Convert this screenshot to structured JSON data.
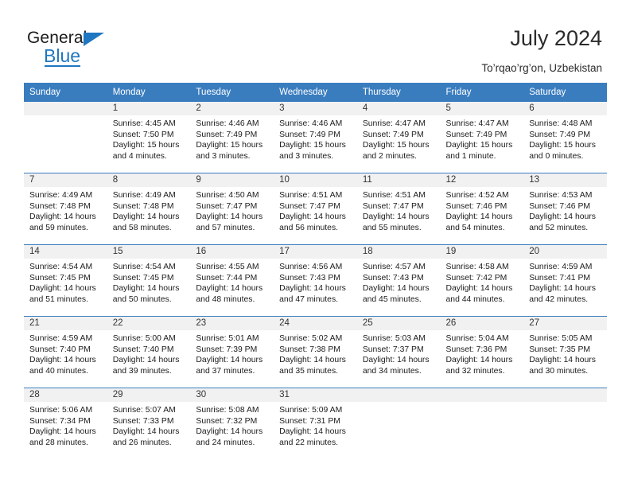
{
  "logo": {
    "word_top": "General",
    "word_bottom": "Blue",
    "triangle_color": "#1f77c1"
  },
  "header": {
    "title": "July 2024",
    "subtitle": "To’rqao’rg’on, Uzbekistan"
  },
  "colors": {
    "header_blue": "#3a7dbf",
    "daynum_band": "#f1f1f1",
    "text": "#1c1c1c"
  },
  "calendar": {
    "weekday_headers": [
      "Sunday",
      "Monday",
      "Tuesday",
      "Wednesday",
      "Thursday",
      "Friday",
      "Saturday"
    ],
    "weeks": [
      [
        {
          "day": "",
          "sunrise": "",
          "sunset": "",
          "daylight_line1": "",
          "daylight_line2": ""
        },
        {
          "day": "1",
          "sunrise": "Sunrise: 4:45 AM",
          "sunset": "Sunset: 7:50 PM",
          "daylight_line1": "Daylight: 15 hours",
          "daylight_line2": "and 4 minutes."
        },
        {
          "day": "2",
          "sunrise": "Sunrise: 4:46 AM",
          "sunset": "Sunset: 7:49 PM",
          "daylight_line1": "Daylight: 15 hours",
          "daylight_line2": "and 3 minutes."
        },
        {
          "day": "3",
          "sunrise": "Sunrise: 4:46 AM",
          "sunset": "Sunset: 7:49 PM",
          "daylight_line1": "Daylight: 15 hours",
          "daylight_line2": "and 3 minutes."
        },
        {
          "day": "4",
          "sunrise": "Sunrise: 4:47 AM",
          "sunset": "Sunset: 7:49 PM",
          "daylight_line1": "Daylight: 15 hours",
          "daylight_line2": "and 2 minutes."
        },
        {
          "day": "5",
          "sunrise": "Sunrise: 4:47 AM",
          "sunset": "Sunset: 7:49 PM",
          "daylight_line1": "Daylight: 15 hours",
          "daylight_line2": "and 1 minute."
        },
        {
          "day": "6",
          "sunrise": "Sunrise: 4:48 AM",
          "sunset": "Sunset: 7:49 PM",
          "daylight_line1": "Daylight: 15 hours",
          "daylight_line2": "and 0 minutes."
        }
      ],
      [
        {
          "day": "7",
          "sunrise": "Sunrise: 4:49 AM",
          "sunset": "Sunset: 7:48 PM",
          "daylight_line1": "Daylight: 14 hours",
          "daylight_line2": "and 59 minutes."
        },
        {
          "day": "8",
          "sunrise": "Sunrise: 4:49 AM",
          "sunset": "Sunset: 7:48 PM",
          "daylight_line1": "Daylight: 14 hours",
          "daylight_line2": "and 58 minutes."
        },
        {
          "day": "9",
          "sunrise": "Sunrise: 4:50 AM",
          "sunset": "Sunset: 7:47 PM",
          "daylight_line1": "Daylight: 14 hours",
          "daylight_line2": "and 57 minutes."
        },
        {
          "day": "10",
          "sunrise": "Sunrise: 4:51 AM",
          "sunset": "Sunset: 7:47 PM",
          "daylight_line1": "Daylight: 14 hours",
          "daylight_line2": "and 56 minutes."
        },
        {
          "day": "11",
          "sunrise": "Sunrise: 4:51 AM",
          "sunset": "Sunset: 7:47 PM",
          "daylight_line1": "Daylight: 14 hours",
          "daylight_line2": "and 55 minutes."
        },
        {
          "day": "12",
          "sunrise": "Sunrise: 4:52 AM",
          "sunset": "Sunset: 7:46 PM",
          "daylight_line1": "Daylight: 14 hours",
          "daylight_line2": "and 54 minutes."
        },
        {
          "day": "13",
          "sunrise": "Sunrise: 4:53 AM",
          "sunset": "Sunset: 7:46 PM",
          "daylight_line1": "Daylight: 14 hours",
          "daylight_line2": "and 52 minutes."
        }
      ],
      [
        {
          "day": "14",
          "sunrise": "Sunrise: 4:54 AM",
          "sunset": "Sunset: 7:45 PM",
          "daylight_line1": "Daylight: 14 hours",
          "daylight_line2": "and 51 minutes."
        },
        {
          "day": "15",
          "sunrise": "Sunrise: 4:54 AM",
          "sunset": "Sunset: 7:45 PM",
          "daylight_line1": "Daylight: 14 hours",
          "daylight_line2": "and 50 minutes."
        },
        {
          "day": "16",
          "sunrise": "Sunrise: 4:55 AM",
          "sunset": "Sunset: 7:44 PM",
          "daylight_line1": "Daylight: 14 hours",
          "daylight_line2": "and 48 minutes."
        },
        {
          "day": "17",
          "sunrise": "Sunrise: 4:56 AM",
          "sunset": "Sunset: 7:43 PM",
          "daylight_line1": "Daylight: 14 hours",
          "daylight_line2": "and 47 minutes."
        },
        {
          "day": "18",
          "sunrise": "Sunrise: 4:57 AM",
          "sunset": "Sunset: 7:43 PM",
          "daylight_line1": "Daylight: 14 hours",
          "daylight_line2": "and 45 minutes."
        },
        {
          "day": "19",
          "sunrise": "Sunrise: 4:58 AM",
          "sunset": "Sunset: 7:42 PM",
          "daylight_line1": "Daylight: 14 hours",
          "daylight_line2": "and 44 minutes."
        },
        {
          "day": "20",
          "sunrise": "Sunrise: 4:59 AM",
          "sunset": "Sunset: 7:41 PM",
          "daylight_line1": "Daylight: 14 hours",
          "daylight_line2": "and 42 minutes."
        }
      ],
      [
        {
          "day": "21",
          "sunrise": "Sunrise: 4:59 AM",
          "sunset": "Sunset: 7:40 PM",
          "daylight_line1": "Daylight: 14 hours",
          "daylight_line2": "and 40 minutes."
        },
        {
          "day": "22",
          "sunrise": "Sunrise: 5:00 AM",
          "sunset": "Sunset: 7:40 PM",
          "daylight_line1": "Daylight: 14 hours",
          "daylight_line2": "and 39 minutes."
        },
        {
          "day": "23",
          "sunrise": "Sunrise: 5:01 AM",
          "sunset": "Sunset: 7:39 PM",
          "daylight_line1": "Daylight: 14 hours",
          "daylight_line2": "and 37 minutes."
        },
        {
          "day": "24",
          "sunrise": "Sunrise: 5:02 AM",
          "sunset": "Sunset: 7:38 PM",
          "daylight_line1": "Daylight: 14 hours",
          "daylight_line2": "and 35 minutes."
        },
        {
          "day": "25",
          "sunrise": "Sunrise: 5:03 AM",
          "sunset": "Sunset: 7:37 PM",
          "daylight_line1": "Daylight: 14 hours",
          "daylight_line2": "and 34 minutes."
        },
        {
          "day": "26",
          "sunrise": "Sunrise: 5:04 AM",
          "sunset": "Sunset: 7:36 PM",
          "daylight_line1": "Daylight: 14 hours",
          "daylight_line2": "and 32 minutes."
        },
        {
          "day": "27",
          "sunrise": "Sunrise: 5:05 AM",
          "sunset": "Sunset: 7:35 PM",
          "daylight_line1": "Daylight: 14 hours",
          "daylight_line2": "and 30 minutes."
        }
      ],
      [
        {
          "day": "28",
          "sunrise": "Sunrise: 5:06 AM",
          "sunset": "Sunset: 7:34 PM",
          "daylight_line1": "Daylight: 14 hours",
          "daylight_line2": "and 28 minutes."
        },
        {
          "day": "29",
          "sunrise": "Sunrise: 5:07 AM",
          "sunset": "Sunset: 7:33 PM",
          "daylight_line1": "Daylight: 14 hours",
          "daylight_line2": "and 26 minutes."
        },
        {
          "day": "30",
          "sunrise": "Sunrise: 5:08 AM",
          "sunset": "Sunset: 7:32 PM",
          "daylight_line1": "Daylight: 14 hours",
          "daylight_line2": "and 24 minutes."
        },
        {
          "day": "31",
          "sunrise": "Sunrise: 5:09 AM",
          "sunset": "Sunset: 7:31 PM",
          "daylight_line1": "Daylight: 14 hours",
          "daylight_line2": "and 22 minutes."
        },
        {
          "day": "",
          "sunrise": "",
          "sunset": "",
          "daylight_line1": "",
          "daylight_line2": ""
        },
        {
          "day": "",
          "sunrise": "",
          "sunset": "",
          "daylight_line1": "",
          "daylight_line2": ""
        },
        {
          "day": "",
          "sunrise": "",
          "sunset": "",
          "daylight_line1": "",
          "daylight_line2": ""
        }
      ]
    ]
  }
}
